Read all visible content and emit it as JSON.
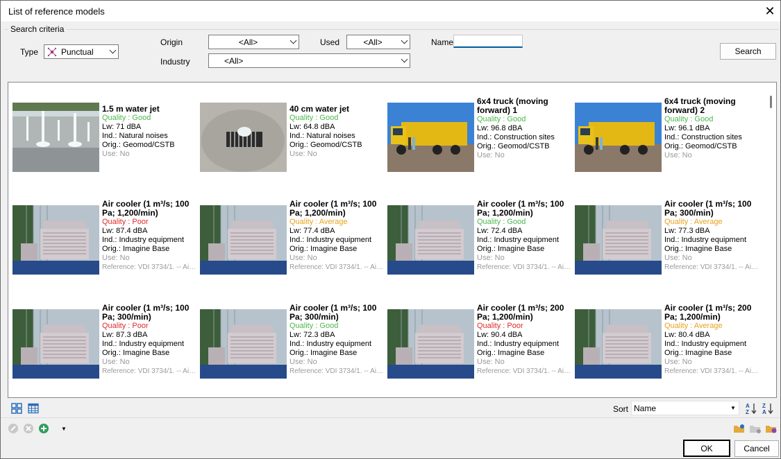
{
  "window": {
    "title": "List of reference models"
  },
  "criteria": {
    "legend": "Search criteria",
    "type_label": "Type",
    "type_value": "Punctual",
    "origin_label": "Origin",
    "origin_value": "<All>",
    "used_label": "Used",
    "used_value": "<All>",
    "name_label": "Name",
    "name_value": "",
    "industry_label": "Industry",
    "industry_value": "<All>",
    "search_button": "Search"
  },
  "models": [
    {
      "name": "1.5 m water jet",
      "quality": "Quality : Good",
      "q": "good",
      "lw": "Lw: 71 dBA",
      "ind": "Ind.: Natural noises",
      "orig": "Orig.: Geomod/CSTB",
      "use": "Use: No",
      "ref": "",
      "img": "fountain"
    },
    {
      "name": "40 cm water jet",
      "quality": "Quality : Good",
      "q": "good",
      "lw": "Lw: 64.8 dBA",
      "ind": "Ind.: Natural noises",
      "orig": "Orig.: Geomod/CSTB",
      "use": "Use: No",
      "ref": "",
      "img": "grate"
    },
    {
      "name": "6x4 truck (moving forward) 1",
      "quality": "Quality : Good",
      "q": "good",
      "lw": "Lw: 96.8 dBA",
      "ind": "Ind.: Construction sites",
      "orig": "Orig.: Geomod/CSTB",
      "use": "Use: No",
      "ref": "",
      "img": "truck"
    },
    {
      "name": "6x4 truck (moving forward) 2",
      "quality": "Quality : Good",
      "q": "good",
      "lw": "Lw: 96.1 dBA",
      "ind": "Ind.: Construction sites",
      "orig": "Orig.: Geomod/CSTB",
      "use": "Use: No",
      "ref": "",
      "img": "truck"
    },
    {
      "name": "Air cooler (1 m³/s; 100 Pa; 1,200/min)",
      "quality": "Quality : Poor",
      "q": "poor",
      "lw": "Lw: 87.4 dBA",
      "ind": "Ind.: Industry equipment",
      "orig": "Orig.: Imagine Base",
      "use": "Use: No",
      "ref": "Reference: VDI 3734/1. -- Air ...",
      "img": "cooler"
    },
    {
      "name": "Air cooler (1 m³/s; 100 Pa; 1,200/min)",
      "quality": "Quality : Average",
      "q": "avg",
      "lw": "Lw: 77.4 dBA",
      "ind": "Ind.: Industry equipment",
      "orig": "Orig.: Imagine Base",
      "use": "Use: No",
      "ref": "Reference: VDI 3734/1. -- Air ...",
      "img": "cooler"
    },
    {
      "name": "Air cooler (1 m³/s; 100 Pa; 1,200/min)",
      "quality": "Quality : Good",
      "q": "good",
      "lw": "Lw: 72.4 dBA",
      "ind": "Ind.: Industry equipment",
      "orig": "Orig.: Imagine Base",
      "use": "Use: No",
      "ref": "Reference: VDI 3734/1. -- Air ...",
      "img": "cooler"
    },
    {
      "name": "Air cooler (1 m³/s; 100 Pa; 300/min)",
      "quality": "Quality : Average",
      "q": "avg",
      "lw": "Lw: 77.3 dBA",
      "ind": "Ind.: Industry equipment",
      "orig": "Orig.: Imagine Base",
      "use": "Use: No",
      "ref": "Reference: VDI 3734/1. -- Air ...",
      "img": "cooler"
    },
    {
      "name": "Air cooler (1 m³/s; 100 Pa; 300/min)",
      "quality": "Quality : Poor",
      "q": "poor",
      "lw": "Lw: 87.3 dBA",
      "ind": "Ind.: Industry equipment",
      "orig": "Orig.: Imagine Base",
      "use": "Use: No",
      "ref": "Reference: VDI 3734/1. -- Air ...",
      "img": "cooler"
    },
    {
      "name": "Air cooler (1 m³/s; 100 Pa; 300/min)",
      "quality": "Quality : Good",
      "q": "good",
      "lw": "Lw: 72.3 dBA",
      "ind": "Ind.: Industry equipment",
      "orig": "Orig.: Imagine Base",
      "use": "Use: No",
      "ref": "Reference: VDI 3734/1. -- Air ...",
      "img": "cooler"
    },
    {
      "name": "Air cooler (1 m³/s; 200 Pa; 1,200/min)",
      "quality": "Quality : Poor",
      "q": "poor",
      "lw": "Lw: 90.4 dBA",
      "ind": "Ind.: Industry equipment",
      "orig": "Orig.: Imagine Base",
      "use": "Use: No",
      "ref": "Reference: VDI 3734/1. -- Air ...",
      "img": "cooler"
    },
    {
      "name": "Air cooler (1 m³/s; 200 Pa; 1,200/min)",
      "quality": "Quality : Average",
      "q": "avg",
      "lw": "Lw: 80.4 dBA",
      "ind": "Ind.: Industry equipment",
      "orig": "Orig.: Imagine Base",
      "use": "Use: No",
      "ref": "Reference: VDI 3734/1. -- Air ...",
      "img": "cooler"
    }
  ],
  "bottom": {
    "sort_label": "Sort",
    "sort_value": "Name",
    "ok_button": "OK",
    "cancel_button": "Cancel"
  },
  "icons": {
    "view_grid": "grid-view-icon",
    "view_table": "table-view-icon",
    "sort_az": "sort-az-icon",
    "sort_za": "sort-za-icon",
    "edit": "edit-icon",
    "delete": "delete-icon",
    "add": "add-icon",
    "dropdown": "dropdown-arrow-icon",
    "folder_open": "open-folder-icon",
    "folder_new": "new-folder-icon",
    "folder_settings": "folder-settings-icon"
  },
  "colors": {
    "quality_good": "#4bb74b",
    "quality_poor": "#e02828",
    "quality_average": "#e8a21a",
    "accent": "#005a9e"
  }
}
